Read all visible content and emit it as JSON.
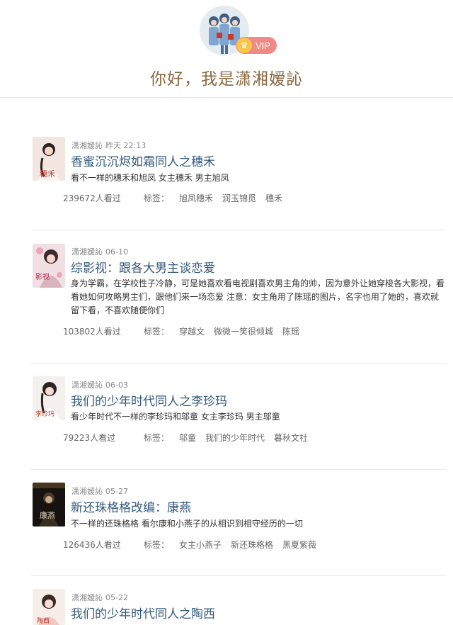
{
  "profile": {
    "vip_badge": "VIP",
    "greeting": "你好，我是潇湘嫒訫"
  },
  "tag_label": "标签：",
  "posts": [
    {
      "author": "潇湘嫒訫",
      "time": "昨天 22:13",
      "title": "香蜜沉沉烬如霜同人之穗禾",
      "description": "看不一样的穗禾和旭凤 女主穗禾 男主旭凤",
      "views": "239672人看过",
      "tags": [
        "旭凤穗禾",
        "润玉锦觅",
        "穗禾"
      ],
      "cover_text": "穗禾"
    },
    {
      "author": "潇湘嫒訫",
      "time": "06-10",
      "title": "综影视：跟各大男主谈恋爱",
      "description": "身为学霸，在学校性子冷静，可是她喜欢看电视剧喜欢男主角的帅，因为意外让她穿梭各大影视，看看她如何攻略男主们，跟他们来一场恋爱 注意：女主角用了陈瑶的图片，名字也用了她的，喜欢就留下看，不喜欢随便你们",
      "views": "103802人看过",
      "tags": [
        "穿越文",
        "微微一笑很倾城",
        "陈瑶"
      ],
      "cover_text": "影视"
    },
    {
      "author": "潇湘嫒訫",
      "time": "06-03",
      "title": "我们的少年时代同人之李珍玛",
      "description": "看少年时代不一样的李珍玛和邬童 女主李珍玛 男主邬童",
      "views": "79223人看过",
      "tags": [
        "邬童",
        "我们的少年时代",
        "暮秋文社"
      ],
      "cover_text": "李珍玛"
    },
    {
      "author": "潇湘嫒訫",
      "time": "05-27",
      "title": "新还珠格格改编：康燕",
      "description": "不一样的还珠格格 看尔康和小燕子的从相识到相守经历的一切",
      "views": "126436人看过",
      "tags": [
        "女主小燕子",
        "新还珠格格",
        "黑夏紫薇"
      ],
      "cover_text": "康燕"
    },
    {
      "author": "潇湘嫒訫",
      "time": "05-22",
      "title": "我们的少年时代同人之陶西",
      "description": "",
      "views": "",
      "tags": [],
      "cover_text": "陶西"
    }
  ],
  "colors": {
    "title_blue": "#34597a",
    "greeting_brown": "#8a6a42",
    "vip_pink": "#ef8a86",
    "crown_gold": "#f6c64a"
  }
}
